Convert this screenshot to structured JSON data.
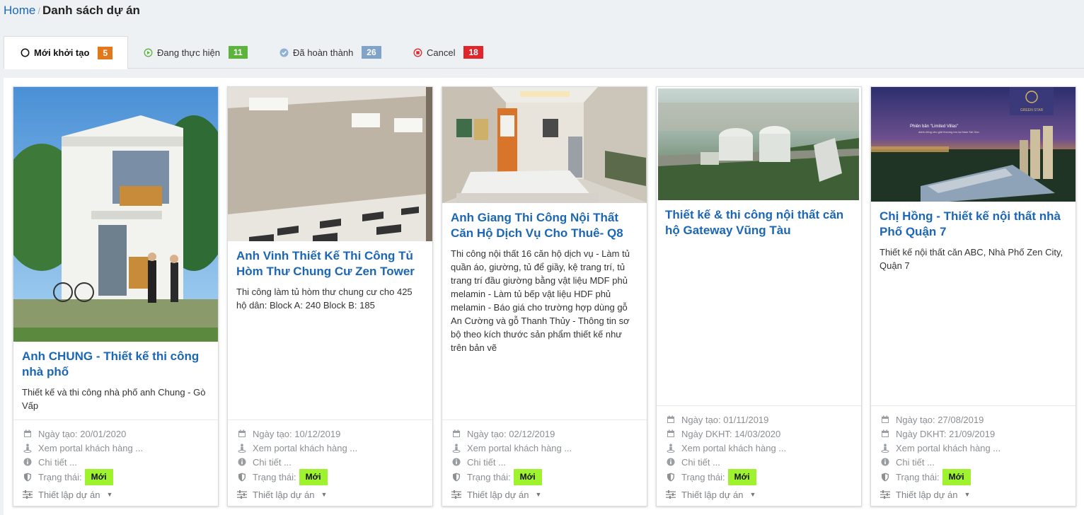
{
  "breadcrumb": {
    "home": "Home",
    "separator": "/",
    "current": "Danh sách dự án"
  },
  "tabs": [
    {
      "label": "Mới khởi tạo",
      "count": "5",
      "icon": "circle-outline-icon",
      "badge_color": "#e2781c"
    },
    {
      "label": "Đang thực hiện",
      "count": "11",
      "icon": "play-circle-icon",
      "badge_color": "#5cb43c"
    },
    {
      "label": "Đã hoàn thành",
      "count": "26",
      "icon": "check-circle-icon",
      "badge_color": "#7fa3c9"
    },
    {
      "label": "Cancel",
      "count": "18",
      "icon": "stop-circle-icon",
      "badge_color": "#e1262b"
    }
  ],
  "footer_labels": {
    "created": "Ngày tạo:",
    "due": "Ngày DKHT:",
    "portal": "Xem portal khách hàng ...",
    "details": "Chi tiết ...",
    "status": "Trạng thái:",
    "setup": "Thiết lập dự án"
  },
  "projects": [
    {
      "title": "Anh CHUNG - Thiết kế thi công nhà phố",
      "description": "Thiết kế và thi công nhà phố anh Chung - Gò Vấp",
      "image": "townhouse-render",
      "created": "20/01/2020",
      "status": "Mới"
    },
    {
      "title": "Anh Vinh Thiết Kế Thi Công Tủ Hòm Thư Chung Cư Zen Tower",
      "description": "Thi công làm tủ hòm thư chung cư cho 425 hộ dân: Block A: 240 Block B: 185",
      "image": "empty-lobby-photo",
      "created": "10/12/2019",
      "status": "Mới"
    },
    {
      "title": "Anh Giang Thi Công Nội Thất Căn Hộ Dịch Vụ Cho Thuê- Q8",
      "description": "Thi công nội thất 16 căn hộ dịch vụ - Làm tủ quần áo, giường, tủ để giầy, kệ trang trí, tủ trang trí đầu giường bằng vật liệu MDF phủ melamin - Làm tủ bếp vật liệu HDF phủ melamin - Báo giá cho trường hợp dùng gỗ An Cường và gỗ Thanh Thủy - Thông tin sơ bộ theo kích thước sản phẩm thiết kế như trên bản vẽ",
      "image": "studio-apartment-interior",
      "created": "02/12/2019",
      "status": "Mới"
    },
    {
      "title": "Thiết kế & thi công nội thất căn hộ Gateway Vũng Tàu",
      "description": "",
      "image": "gateway-aerial-render",
      "created": "01/11/2019",
      "due": "14/03/2020",
      "status": "Mới"
    },
    {
      "title": "Chị Hồng - Thiết kế nội thất nhà Phố Quận 7",
      "description": "Thiết kế nội thất căn ABC, Nhà Phố Zen City, Quận 7",
      "image": "limited-villas-night-render",
      "image_text": {
        "headline": "Phiên bản \"Limited Villas\"",
        "sub": "dành riêng cho giới thượng lưu tại Nam Sài Gòn",
        "brand": "GREEN STAR"
      },
      "created": "27/08/2019",
      "due": "21/09/2019",
      "status": "Mới"
    }
  ],
  "colors": {
    "link": "#1c66b6",
    "status_new": "#9ff22e"
  }
}
